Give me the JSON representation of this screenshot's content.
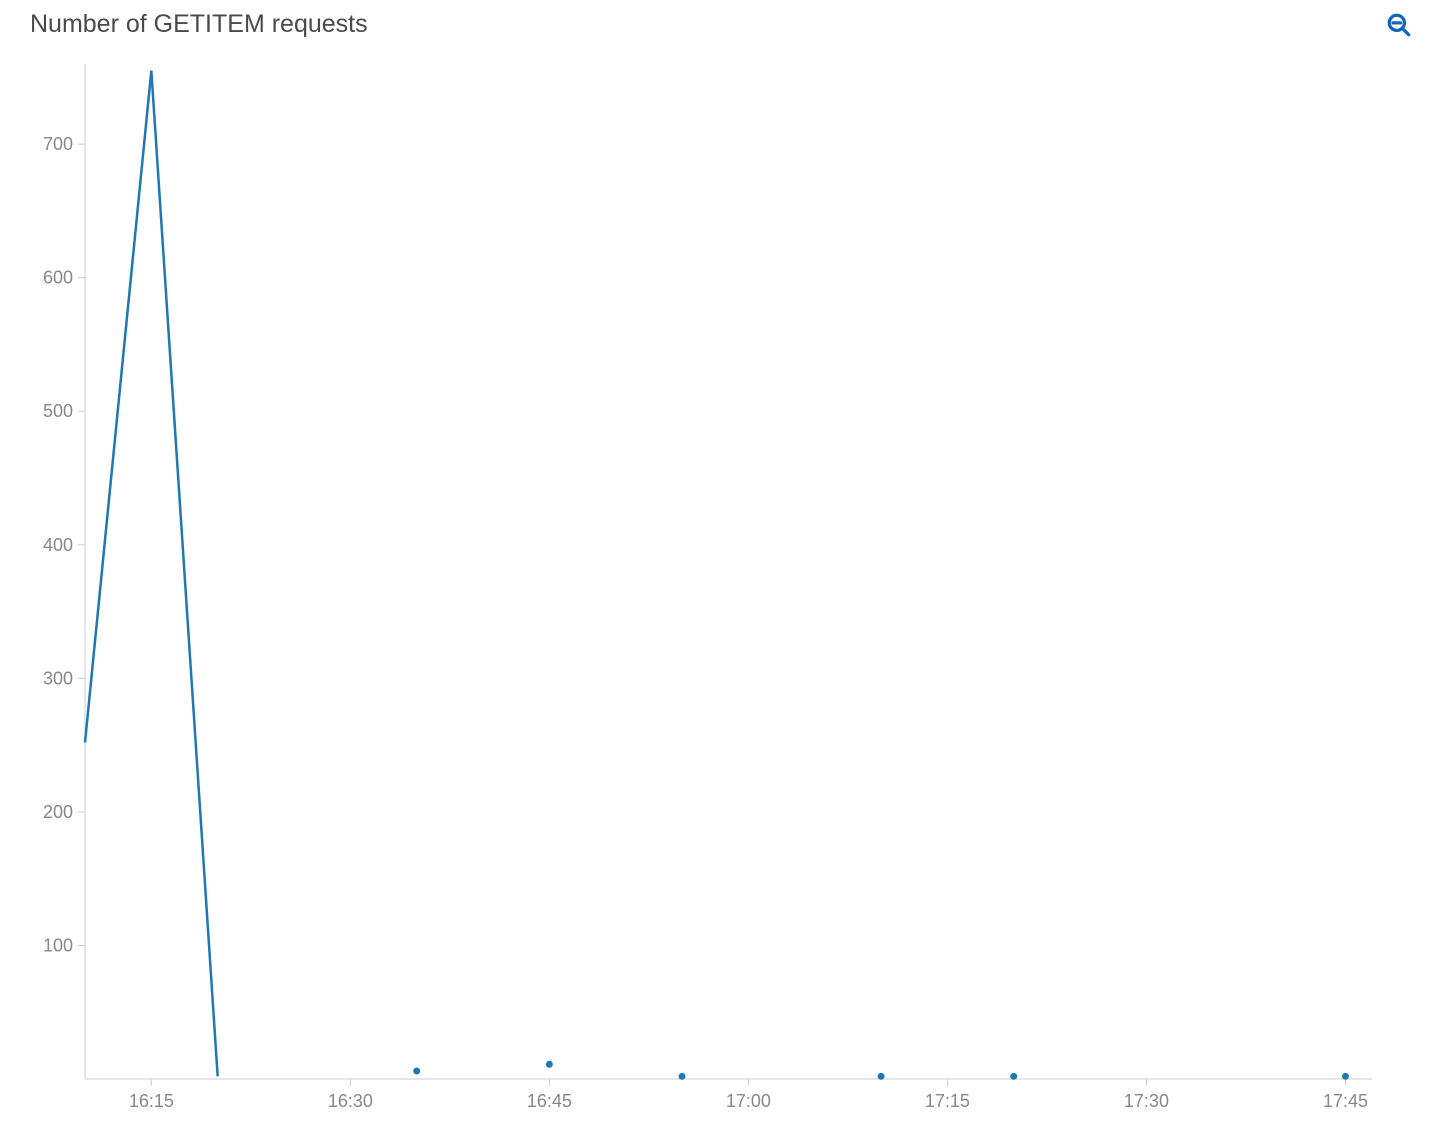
{
  "title": "Number of GETITEM requests",
  "zoom_icon": "zoom-out-icon",
  "chart_data": {
    "type": "line",
    "title": "Number of GETITEM requests",
    "xlabel": "",
    "ylabel": "",
    "ylim": [
      0,
      760
    ],
    "xlim": [
      "16:10",
      "17:47"
    ],
    "y_ticks": [
      100,
      200,
      300,
      400,
      500,
      600,
      700
    ],
    "x_ticks": [
      "16:15",
      "16:30",
      "16:45",
      "17:00",
      "17:15",
      "17:30",
      "17:45"
    ],
    "series": [
      {
        "name": "GETITEM requests",
        "segments": [
          {
            "type": "line",
            "points": [
              {
                "x": "16:10",
                "y": 252
              },
              {
                "x": "16:15",
                "y": 755
              },
              {
                "x": "16:20",
                "y": 2
              }
            ]
          },
          {
            "type": "points",
            "points": [
              {
                "x": "16:35",
                "y": 6
              },
              {
                "x": "16:45",
                "y": 11
              },
              {
                "x": "16:55",
                "y": 2
              },
              {
                "x": "17:10",
                "y": 2
              },
              {
                "x": "17:20",
                "y": 2
              },
              {
                "x": "17:45",
                "y": 2
              }
            ]
          }
        ]
      }
    ]
  }
}
